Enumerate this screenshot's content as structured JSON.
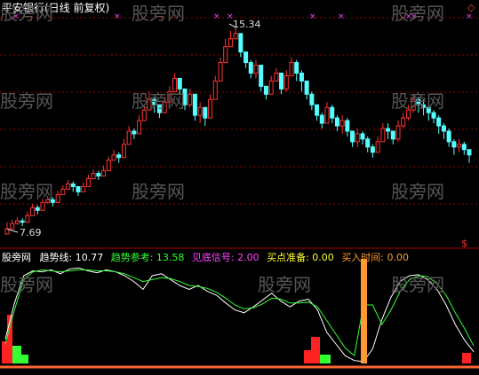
{
  "price_panel": {
    "title": "平安银行(日线 前复权)",
    "high_label": "15.34",
    "low_label": "7.69",
    "marker": "$",
    "diamond": "◇"
  },
  "indicator_panel": {
    "legend": [
      {
        "label": "股旁网",
        "color": "#ffffff"
      },
      {
        "label": "趋势线: 10.77",
        "color": "#ffffff"
      },
      {
        "label": "趋势参考: 13.58",
        "color": "#33ff33"
      },
      {
        "label": "见底信号: 2.00",
        "color": "#ff44ff"
      },
      {
        "label": "买点准备: 0.00",
        "color": "#ffff33"
      },
      {
        "label": "买入时间: 0.00",
        "color": "#ff9933"
      }
    ]
  },
  "watermarks": [
    "股旁网",
    "股旁网",
    "股旁网",
    "股旁网",
    "股旁网",
    "股旁网",
    "股旁网",
    "股旁网",
    "股旁网",
    "股旁网",
    "股旁网",
    "股旁网"
  ],
  "colors": {
    "up": "#ff3333",
    "down": "#55ffff",
    "trend_line": "#ffffff",
    "trend_ref": "#33ff33",
    "buy_time": "#ff9933",
    "grid": "#990000"
  },
  "chart_data": [
    {
      "type": "candlestick",
      "title": "平安银行(日线 前复权)",
      "ylim": [
        7.3,
        15.9
      ],
      "annotations": [
        {
          "label": "15.34",
          "value": 15.34
        },
        {
          "label": "7.69",
          "value": 7.69
        }
      ],
      "close": [
        7.7,
        7.9,
        8.0,
        7.95,
        8.2,
        8.5,
        8.4,
        8.7,
        8.8,
        8.7,
        9.0,
        9.2,
        9.4,
        9.3,
        9.1,
        9.3,
        9.6,
        9.8,
        9.7,
        9.9,
        10.3,
        10.5,
        10.4,
        10.9,
        11.4,
        11.3,
        11.8,
        12.2,
        12.6,
        12.4,
        12.1,
        12.5,
        12.9,
        13.4,
        13.0,
        12.4,
        12.8,
        12.0,
        12.3,
        11.9,
        12.6,
        13.3,
        14.0,
        14.6,
        14.9,
        15.1,
        14.4,
        14.0,
        13.6,
        13.9,
        13.1,
        12.8,
        13.3,
        13.6,
        13.0,
        13.5,
        14.0,
        13.6,
        13.3,
        12.8,
        12.4,
        12.0,
        11.7,
        12.3,
        11.9,
        11.6,
        11.8,
        11.4,
        11.0,
        11.3,
        11.1,
        10.8,
        10.6,
        11.0,
        11.5,
        11.4,
        11.1,
        11.6,
        11.9,
        12.2,
        12.6,
        12.4,
        12.3,
        12.1,
        11.9,
        11.6,
        11.4,
        11.0,
        10.8,
        10.9,
        10.7,
        10.5
      ],
      "high": [
        7.95,
        8.05,
        8.15,
        8.1,
        8.35,
        8.65,
        8.6,
        8.85,
        8.95,
        8.9,
        9.15,
        9.35,
        9.55,
        9.5,
        9.3,
        9.45,
        9.75,
        9.95,
        9.9,
        10.1,
        10.45,
        10.7,
        10.6,
        11.1,
        11.6,
        11.5,
        12.0,
        12.4,
        12.9,
        12.7,
        12.4,
        12.7,
        13.1,
        13.6,
        13.4,
        12.7,
        13.0,
        12.5,
        12.5,
        12.2,
        12.8,
        13.5,
        14.2,
        14.9,
        15.2,
        15.34,
        14.9,
        14.3,
        14.1,
        14.1,
        13.6,
        13.1,
        13.5,
        13.8,
        13.5,
        13.7,
        14.2,
        14.1,
        13.7,
        13.3,
        12.9,
        12.4,
        12.1,
        12.5,
        12.4,
        12.0,
        12.0,
        11.9,
        11.4,
        11.5,
        11.4,
        11.2,
        10.9,
        11.2,
        11.7,
        11.7,
        11.4,
        11.8,
        12.1,
        12.4,
        12.8,
        12.7,
        12.6,
        12.5,
        12.2,
        12.0,
        11.7,
        11.5,
        11.1,
        11.1,
        11.0,
        10.7
      ],
      "low": [
        7.69,
        7.75,
        7.85,
        7.8,
        8.0,
        8.3,
        8.25,
        8.5,
        8.65,
        8.55,
        8.85,
        9.05,
        9.25,
        9.1,
        8.95,
        9.15,
        9.4,
        9.6,
        9.55,
        9.75,
        10.1,
        10.3,
        10.2,
        10.6,
        11.2,
        11.1,
        11.6,
        12.0,
        12.4,
        12.1,
        11.9,
        12.2,
        12.7,
        13.1,
        12.8,
        12.2,
        12.3,
        11.8,
        11.7,
        11.6,
        12.0,
        12.9,
        13.7,
        14.2,
        14.6,
        14.9,
        14.2,
        13.8,
        13.4,
        13.4,
        12.9,
        12.6,
        12.8,
        13.3,
        12.8,
        12.9,
        13.6,
        13.3,
        12.9,
        12.6,
        12.2,
        11.8,
        11.5,
        11.8,
        11.7,
        11.4,
        11.3,
        11.2,
        10.8,
        10.8,
        10.9,
        10.6,
        10.4,
        10.6,
        11.0,
        11.1,
        10.9,
        11.0,
        11.5,
        11.8,
        12.1,
        12.1,
        12.0,
        11.8,
        11.7,
        11.3,
        11.1,
        10.8,
        10.5,
        10.6,
        10.5,
        10.2
      ]
    },
    {
      "type": "line",
      "ylim": [
        0,
        100
      ],
      "series": [
        {
          "name": "趋势线",
          "values": [
            25,
            62,
            90,
            95,
            94,
            96,
            92,
            97,
            98,
            95,
            93,
            96,
            94,
            90,
            84,
            76,
            90,
            92,
            86,
            80,
            76,
            80,
            74,
            70,
            62,
            55,
            52,
            58,
            65,
            72,
            64,
            58,
            64,
            66,
            55,
            32,
            20,
            8,
            3,
            2,
            15,
            45,
            68,
            84,
            90,
            91,
            86,
            76,
            60,
            40,
            24,
            12
          ]
        },
        {
          "name": "趋势参考",
          "values": [
            20,
            55,
            86,
            94,
            96,
            95,
            94,
            95,
            96,
            96,
            95,
            95,
            94,
            92,
            88,
            84,
            86,
            88,
            87,
            84,
            80,
            79,
            77,
            73,
            67,
            60,
            56,
            57,
            61,
            67,
            66,
            62,
            62,
            63,
            58,
            44,
            30,
            16,
            8,
            60,
            60,
            40,
            55,
            74,
            86,
            90,
            89,
            82,
            70,
            52,
            36,
            18
          ]
        },
        {
          "name": "买入时间",
          "values": [
            0,
            0,
            0,
            0,
            0,
            0,
            0,
            0,
            0,
            0,
            0,
            0,
            0,
            0,
            0,
            0,
            0,
            0,
            0,
            0,
            0,
            0,
            0,
            0,
            0,
            0,
            0,
            0,
            0,
            0,
            0,
            0,
            0,
            0,
            0,
            0,
            0,
            0,
            0,
            100,
            0,
            0,
            0,
            0,
            0,
            0,
            0,
            0,
            0,
            0,
            0,
            0
          ]
        }
      ]
    }
  ]
}
